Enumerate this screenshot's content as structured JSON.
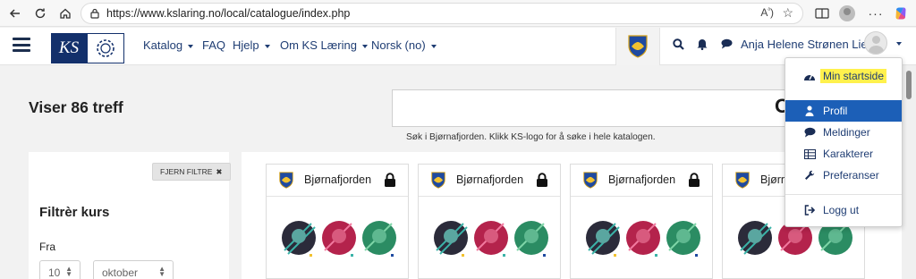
{
  "browser": {
    "url": "https://www.kslaring.no/local/catalogue/index.php",
    "read_aloud_label": "A",
    "toolbar_icons": [
      "back-icon",
      "refresh-icon",
      "home-icon",
      "lock-icon",
      "read-aloud-icon",
      "favorite-star-icon",
      "split-screen-icon",
      "favorites-icon",
      "profile-icon",
      "more-icon",
      "copilot-icon"
    ]
  },
  "navbar": {
    "logo_text": "KS",
    "menu": [
      {
        "label": "Katalog",
        "has_caret": true
      },
      {
        "label": "FAQ",
        "has_caret": false
      },
      {
        "label": "Hjelp",
        "has_caret": true
      },
      {
        "label": "Om KS Læring",
        "has_caret": true
      },
      {
        "label": "Norsk (no)",
        "has_caret": true
      }
    ],
    "user_name": "Anja Helene Strønen Lien",
    "icons": [
      "search-icon",
      "bell-icon",
      "chat-icon"
    ]
  },
  "main": {
    "result_count": "Viser 86 treff",
    "search_hint": "Søk i Bjørnafjorden. Klikk KS-logo for å søke i hele katalogen.",
    "search_icon_char": "O"
  },
  "filter": {
    "clear_label": "FJERN FILTRE",
    "clear_icon": "✖",
    "title": "Filtrèr kurs",
    "from_label": "Fra",
    "day_value": "10",
    "month_value": "oktober"
  },
  "cards": [
    {
      "org": "Bjørnafjorden"
    },
    {
      "org": "Bjørnafjorden"
    },
    {
      "org": "Bjørnafjorden"
    },
    {
      "org": "Bjørnafjorden"
    }
  ],
  "dropdown": {
    "items": [
      {
        "label": "Min startside",
        "icon": "dashboard-icon",
        "highlighted": true
      },
      {
        "label": "Profil",
        "icon": "user-icon",
        "active": true
      },
      {
        "label": "Meldinger",
        "icon": "chat-icon"
      },
      {
        "label": "Karakterer",
        "icon": "table-icon"
      },
      {
        "label": "Preferanser",
        "icon": "wrench-icon"
      },
      {
        "label": "Logg ut",
        "icon": "logout-icon"
      }
    ]
  },
  "colors": {
    "brand_navy": "#13306b",
    "link_blue": "#1f3d73",
    "active_blue": "#1c5fb7",
    "highlight_yellow": "#fff14d"
  }
}
